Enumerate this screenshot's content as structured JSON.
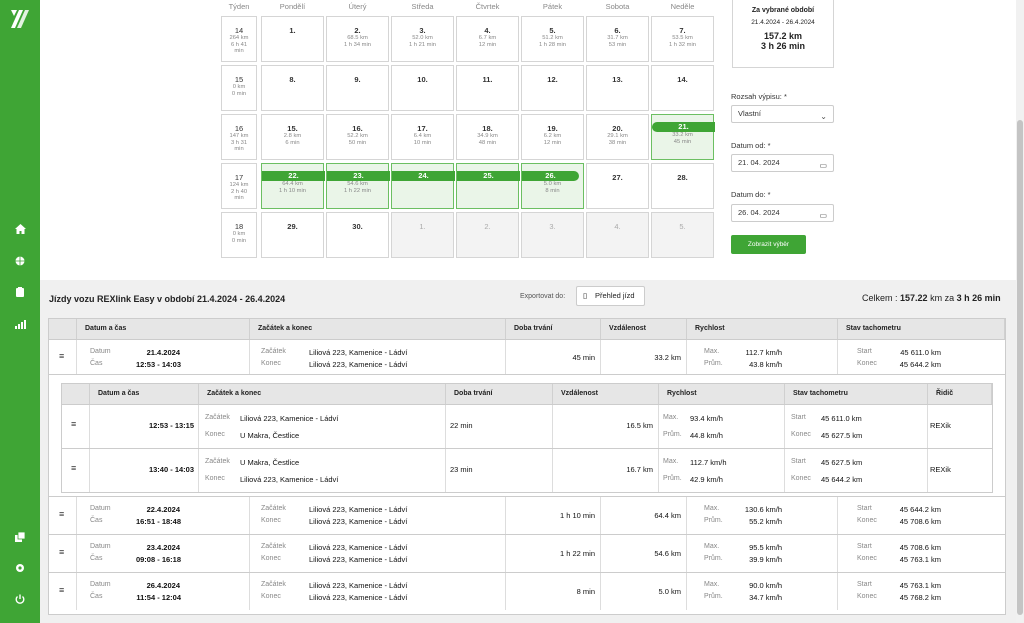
{
  "colors": {
    "accent": "#3fa535",
    "selected_bg": "#eaf5e8"
  },
  "sidebar": {
    "icons": [
      "logo-icon",
      "home-icon",
      "globe-icon",
      "clipboard-icon",
      "chart-icon",
      "layers-icon",
      "gear-icon",
      "power-icon"
    ]
  },
  "calendar": {
    "headers": [
      "Týden",
      "Pondělí",
      "Úterý",
      "Středa",
      "Čtvrtek",
      "Pátek",
      "Sobota",
      "Neděle"
    ],
    "weeks": [
      {
        "week": "14",
        "s1": "264 km",
        "s2": "6 h 41",
        "s3": "min",
        "days": [
          {
            "d": "1.",
            "s1": "",
            "s2": ""
          },
          {
            "d": "2.",
            "s1": "68.5 km",
            "s2": "1 h 34 min"
          },
          {
            "d": "3.",
            "s1": "52.0 km",
            "s2": "1 h 21 min"
          },
          {
            "d": "4.",
            "s1": "6.7 km",
            "s2": "12 min"
          },
          {
            "d": "5.",
            "s1": "51.2 km",
            "s2": "1 h 28 min"
          },
          {
            "d": "6.",
            "s1": "31.7 km",
            "s2": "53 min"
          },
          {
            "d": "7.",
            "s1": "53.5 km",
            "s2": "1 h 32 min"
          }
        ]
      },
      {
        "week": "15",
        "s1": "0 km",
        "s2": "0 min",
        "s3": "",
        "days": [
          {
            "d": "8.",
            "s1": "",
            "s2": ""
          },
          {
            "d": "9.",
            "s1": "",
            "s2": ""
          },
          {
            "d": "10.",
            "s1": "",
            "s2": ""
          },
          {
            "d": "11.",
            "s1": "",
            "s2": ""
          },
          {
            "d": "12.",
            "s1": "",
            "s2": ""
          },
          {
            "d": "13.",
            "s1": "",
            "s2": ""
          },
          {
            "d": "14.",
            "s1": "",
            "s2": ""
          }
        ]
      },
      {
        "week": "16",
        "s1": "147 km",
        "s2": "3 h 31",
        "s3": "min",
        "days": [
          {
            "d": "15.",
            "s1": "2.8 km",
            "s2": "6 min"
          },
          {
            "d": "16.",
            "s1": "52.2 km",
            "s2": "50 min"
          },
          {
            "d": "17.",
            "s1": "6.4 km",
            "s2": "10 min"
          },
          {
            "d": "18.",
            "s1": "34.9 km",
            "s2": "48 min"
          },
          {
            "d": "19.",
            "s1": "6.2 km",
            "s2": "12 min"
          },
          {
            "d": "20.",
            "s1": "29.1 km",
            "s2": "38 min"
          },
          {
            "d": "21.",
            "s1": "33.2 km",
            "s2": "45 min"
          }
        ]
      },
      {
        "week": "17",
        "s1": "124 km",
        "s2": "2 h 40",
        "s3": "min",
        "days": [
          {
            "d": "22.",
            "s1": "64.4 km",
            "s2": "1 h 10 min"
          },
          {
            "d": "23.",
            "s1": "54.6 km",
            "s2": "1 h 22 min"
          },
          {
            "d": "24.",
            "s1": "",
            "s2": ""
          },
          {
            "d": "25.",
            "s1": "",
            "s2": ""
          },
          {
            "d": "26.",
            "s1": "5.0 km",
            "s2": "8 min"
          },
          {
            "d": "27.",
            "s1": "",
            "s2": ""
          },
          {
            "d": "28.",
            "s1": "",
            "s2": ""
          }
        ]
      },
      {
        "week": "18",
        "s1": "0 km",
        "s2": "0 min",
        "s3": "",
        "days": [
          {
            "d": "29.",
            "s1": "",
            "s2": ""
          },
          {
            "d": "30.",
            "s1": "",
            "s2": ""
          },
          {
            "d": "1.",
            "s1": "",
            "s2": ""
          },
          {
            "d": "2.",
            "s1": "",
            "s2": ""
          },
          {
            "d": "3.",
            "s1": "",
            "s2": ""
          },
          {
            "d": "4.",
            "s1": "",
            "s2": ""
          },
          {
            "d": "5.",
            "s1": "",
            "s2": ""
          }
        ]
      }
    ]
  },
  "summary": {
    "title": "Za vybrané období",
    "period": "21.4.2024 - 26.4.2024",
    "km": "157.2 km",
    "time": "3 h 26 min"
  },
  "filter": {
    "range_label": "Rozsah výpisu: *",
    "range_value": "Vlastní",
    "from_label": "Datum od: *",
    "from_value": "21. 04. 2024",
    "to_label": "Datum do: *",
    "to_value": "26. 04. 2024",
    "button": "Zobrazit výběr"
  },
  "trips": {
    "title": "Jízdy vozu REXlink Easy v období 21.4.2024 - 26.4.2024",
    "export_label": "Exportovat do:",
    "export_button": "Přehled jízd",
    "total_prefix": "Celkem :",
    "total_km": "157.22",
    "total_mid": "km za",
    "total_time": "3 h 26 min",
    "headers": [
      "Datum a čas",
      "Začátek a konec",
      "Doba trvání",
      "Vzdálenost",
      "Rychlost",
      "Stav tachometru"
    ],
    "labels": {
      "datum": "Datum",
      "cas": "Čas",
      "zacatek": "Začátek",
      "konec": "Konec",
      "max": "Max.",
      "prum": "Prům.",
      "start": "Start",
      "konec_t": "Konec"
    },
    "rows": [
      {
        "date": "21.4.2024",
        "time": "12:53 - 14:03",
        "start": "Liliová 223, Kamenice - Ládví",
        "end": "Liliová 223, Kamenice - Ládví",
        "dur": "45 min",
        "dist": "33.2 km",
        "max": "112.7 km/h",
        "avg": "43.8 km/h",
        "tstart": "45 611.0 km",
        "tend": "45 644.2 km"
      },
      {
        "date": "22.4.2024",
        "time": "16:51 - 18:48",
        "start": "Liliová 223, Kamenice - Ládví",
        "end": "Liliová 223, Kamenice - Ládví",
        "dur": "1 h 10 min",
        "dist": "64.4 km",
        "max": "130.6 km/h",
        "avg": "55.2 km/h",
        "tstart": "45 644.2 km",
        "tend": "45 708.6 km"
      },
      {
        "date": "23.4.2024",
        "time": "09:08 - 16:18",
        "start": "Liliová 223, Kamenice - Ládví",
        "end": "Liliová 223, Kamenice - Ládví",
        "dur": "1 h 22 min",
        "dist": "54.6 km",
        "max": "95.5 km/h",
        "avg": "39.9 km/h",
        "tstart": "45 708.6 km",
        "tend": "45 763.1 km"
      },
      {
        "date": "26.4.2024",
        "time": "11:54 - 12:04",
        "start": "Liliová 223, Kamenice - Ládví",
        "end": "Liliová 223, Kamenice - Ládví",
        "dur": "8 min",
        "dist": "5.0 km",
        "max": "90.0 km/h",
        "avg": "34.7 km/h",
        "tstart": "45 763.1 km",
        "tend": "45 768.2 km"
      }
    ],
    "sub_headers": [
      "Datum a čas",
      "Začátek a konec",
      "Doba trvání",
      "Vzdálenost",
      "Rychlost",
      "Stav tachometru",
      "Řidič"
    ],
    "sub_rows": [
      {
        "time": "12:53 - 13:15",
        "start": "Liliová 223, Kamenice - Ládví",
        "end": "U Makra, Čestlice",
        "dur": "22 min",
        "dist": "16.5 km",
        "max": "93.4 km/h",
        "avg": "44.8 km/h",
        "tstart": "45 611.0 km",
        "tend": "45 627.5 km",
        "driver": "REXik"
      },
      {
        "time": "13:40 - 14:03",
        "start": "U Makra, Čestlice",
        "end": "Liliová 223, Kamenice - Ládví",
        "dur": "23 min",
        "dist": "16.7 km",
        "max": "112.7 km/h",
        "avg": "42.9 km/h",
        "tstart": "45 627.5 km",
        "tend": "45 644.2 km",
        "driver": "REXik"
      }
    ]
  }
}
